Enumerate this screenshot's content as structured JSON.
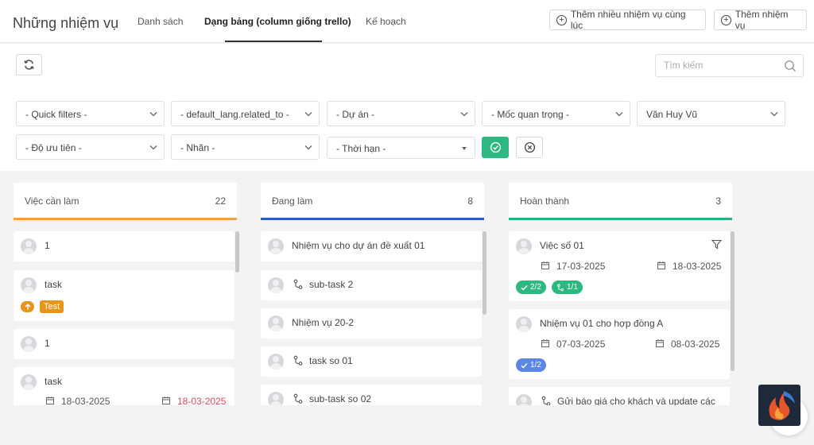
{
  "header": {
    "title": "Những nhiệm vụ",
    "tabs": [
      {
        "label": "Danh sách"
      },
      {
        "label": "Dạng bảng (column giống trello)"
      },
      {
        "label": "Kế hoạch"
      }
    ],
    "add_multiple_label": "Thêm nhiều nhiệm vụ cùng lúc",
    "add_task_label": "Thêm nhiệm vụ"
  },
  "filters": {
    "search_placeholder": "Tìm kiếm",
    "quick_filters": "- Quick filters -",
    "related_to": "- default_lang.related_to -",
    "project": "- Dự án -",
    "milestone": "- Mốc quan trọng -",
    "assignee": "Văn Huy Vũ",
    "priority": "- Độ ưu tiên -",
    "label": "- Nhãn -",
    "deadline": "- Thời hạn -"
  },
  "colors": {
    "todo": "#f4a042",
    "doing": "#2563b8",
    "done": "#25b683",
    "green": "#2db87d",
    "blue_pill": "#5b86e5",
    "overdue": "#e24b5b",
    "orange": "#e8941a"
  },
  "columns": [
    {
      "title": "Việc cần làm",
      "count": "22",
      "cards": [
        {
          "text": "1"
        },
        {
          "text": "task",
          "tag": "Test"
        },
        {
          "text": "1"
        },
        {
          "text": "task",
          "start": "18-03-2025",
          "end": "18-03-2025"
        }
      ]
    },
    {
      "title": "Đang làm",
      "count": "8",
      "cards": [
        {
          "text": "Nhiệm vụ cho dự án đề xuất 01"
        },
        {
          "text": "sub-task 2"
        },
        {
          "text": "Nhiệm vụ 20-2"
        },
        {
          "text": "task so 01"
        },
        {
          "text": "sub-task so 02"
        }
      ]
    },
    {
      "title": "Hoàn thành",
      "count": "3",
      "cards": [
        {
          "text": "Việc số 01",
          "start": "17-03-2025",
          "end": "18-03-2025",
          "checklist": "2/2",
          "subtasks": "1/1"
        },
        {
          "text": "Nhiệm vụ 01 cho hợp đồng A",
          "start": "07-03-2025",
          "end": "08-03-2025",
          "checklist": "1/2"
        },
        {
          "text": "Gửi báo giá cho khách và update các"
        }
      ]
    }
  ]
}
